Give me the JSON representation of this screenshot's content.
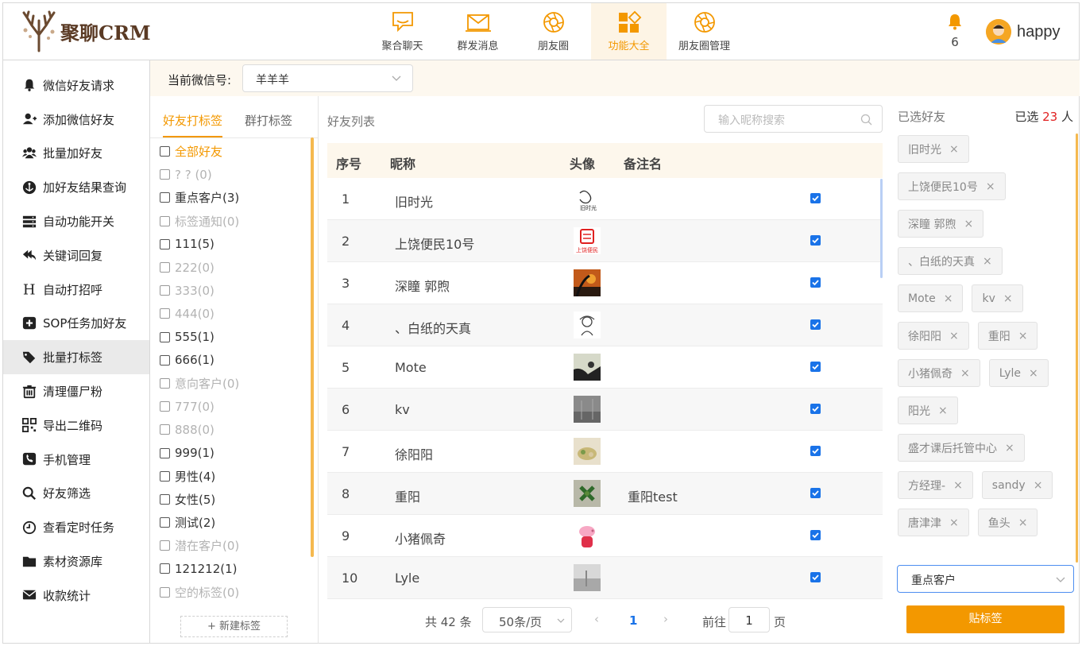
{
  "brand": {
    "name": "聚聊CRM"
  },
  "nav": [
    {
      "label": "聚合聊天",
      "icon": "chat-icon",
      "active": false
    },
    {
      "label": "群发消息",
      "icon": "mail-icon",
      "active": false
    },
    {
      "label": "朋友圈",
      "icon": "aperture-icon",
      "active": false
    },
    {
      "label": "功能大全",
      "icon": "grid-icon",
      "active": true
    },
    {
      "label": "朋友圈管理",
      "icon": "aperture-icon",
      "active": false
    }
  ],
  "notifications": {
    "count": "6"
  },
  "user": {
    "name": "happy"
  },
  "sidebar": {
    "items": [
      {
        "label": "微信好友请求",
        "icon": "bell-icon"
      },
      {
        "label": "添加微信好友",
        "icon": "add-user-icon"
      },
      {
        "label": "批量加好友",
        "icon": "users-icon"
      },
      {
        "label": "加好友结果查询",
        "icon": "anchor-icon"
      },
      {
        "label": "自动功能开关",
        "icon": "server-icon"
      },
      {
        "label": "关键词回复",
        "icon": "reply-all-icon"
      },
      {
        "label": "自动打招呼",
        "icon": "heading-icon"
      },
      {
        "label": "SOP任务加好友",
        "icon": "plus-square-icon"
      },
      {
        "label": "批量打标签",
        "icon": "tags-icon"
      },
      {
        "label": "清理僵尸粉",
        "icon": "trash-icon"
      },
      {
        "label": "导出二维码",
        "icon": "qrcode-icon"
      },
      {
        "label": "手机管理",
        "icon": "phone-icon"
      },
      {
        "label": "好友筛选",
        "icon": "search-icon"
      },
      {
        "label": "查看定时任务",
        "icon": "clock-icon"
      },
      {
        "label": "素材资源库",
        "icon": "folder-icon"
      },
      {
        "label": "收款统计",
        "icon": "envelope-icon"
      }
    ],
    "active_index": 8
  },
  "topbar": {
    "label": "当前微信号:",
    "account": "羊羊羊"
  },
  "tag_panel": {
    "tabs": [
      {
        "label": "好友打标签",
        "active": true
      },
      {
        "label": "群打标签",
        "active": false
      }
    ],
    "tags": [
      {
        "label": "全部好友",
        "style": "hl"
      },
      {
        "label": "? ? (0)",
        "style": "mute"
      },
      {
        "label": "重点客户(3)",
        "style": "norm"
      },
      {
        "label": "标签通知(0)",
        "style": "mute"
      },
      {
        "label": "111(5)",
        "style": "norm"
      },
      {
        "label": "222(0)",
        "style": "mute"
      },
      {
        "label": "333(0)",
        "style": "mute"
      },
      {
        "label": "444(0)",
        "style": "mute"
      },
      {
        "label": "555(1)",
        "style": "norm"
      },
      {
        "label": "666(1)",
        "style": "norm"
      },
      {
        "label": "意向客户(0)",
        "style": "mute"
      },
      {
        "label": "777(0)",
        "style": "mute"
      },
      {
        "label": "888(0)",
        "style": "mute"
      },
      {
        "label": "999(1)",
        "style": "norm"
      },
      {
        "label": "男性(4)",
        "style": "norm"
      },
      {
        "label": "女性(5)",
        "style": "norm"
      },
      {
        "label": "测试(2)",
        "style": "norm"
      },
      {
        "label": "潜在客户(0)",
        "style": "mute"
      },
      {
        "label": "121212(1)",
        "style": "norm"
      },
      {
        "label": "空的标签(0)",
        "style": "mute"
      }
    ],
    "new_tag": "+ 新建标签"
  },
  "friend_list": {
    "title": "好友列表",
    "search_placeholder": "输入昵称搜索",
    "columns": {
      "no": "序号",
      "name": "昵称",
      "avatar": "头像",
      "remark": "备注名"
    },
    "rows": [
      {
        "no": "1",
        "name": "旧时光",
        "remark": "",
        "avatar": "sketch-avatar",
        "checked": true
      },
      {
        "no": "2",
        "name": "上饶便民10号",
        "remark": "",
        "avatar": "logo-avatar",
        "checked": true
      },
      {
        "no": "3",
        "name": "深瞳 郭煦",
        "remark": "",
        "avatar": "sunset-avatar",
        "checked": true
      },
      {
        "no": "4",
        "name": "、白纸的天真",
        "remark": "",
        "avatar": "doodle-avatar",
        "checked": true
      },
      {
        "no": "5",
        "name": "Mote",
        "remark": "",
        "avatar": "silhouette-avatar",
        "checked": true
      },
      {
        "no": "6",
        "name": "kv",
        "remark": "",
        "avatar": "grey-avatar",
        "checked": true
      },
      {
        "no": "7",
        "name": "徐阳阳",
        "remark": "",
        "avatar": "food-avatar",
        "checked": true
      },
      {
        "no": "8",
        "name": "重阳",
        "remark": "重阳test",
        "avatar": "plant-avatar",
        "checked": true
      },
      {
        "no": "9",
        "name": "小猪佩奇",
        "remark": "",
        "avatar": "peppa-avatar",
        "checked": true
      },
      {
        "no": "10",
        "name": "Lyle",
        "remark": "",
        "avatar": "fog-avatar",
        "checked": true
      }
    ],
    "pager": {
      "total": "共 42 条",
      "page_size": "50条/页",
      "current": "1",
      "goto_label": "前往",
      "goto_value": "1",
      "goto_suffix": "页"
    }
  },
  "selected_panel": {
    "title": "已选好友",
    "count_prefix": "已选",
    "count": "23",
    "count_suffix": "人",
    "chips": [
      "旧时光",
      "上饶便民10号",
      "深瞳 郭煦",
      "、白纸的天真",
      "Mote",
      "kv",
      "徐阳阳",
      "重阳",
      "小猪佩奇",
      "Lyle",
      "阳光",
      "盛才课后托管中心",
      "方经理-",
      "sandy",
      "唐津津",
      "鱼头"
    ],
    "tag_select": "重点客户",
    "apply_button": "贴标签"
  },
  "colors": {
    "accent": "#f39800",
    "link": "#1a73e8",
    "count_red": "#e02020"
  }
}
